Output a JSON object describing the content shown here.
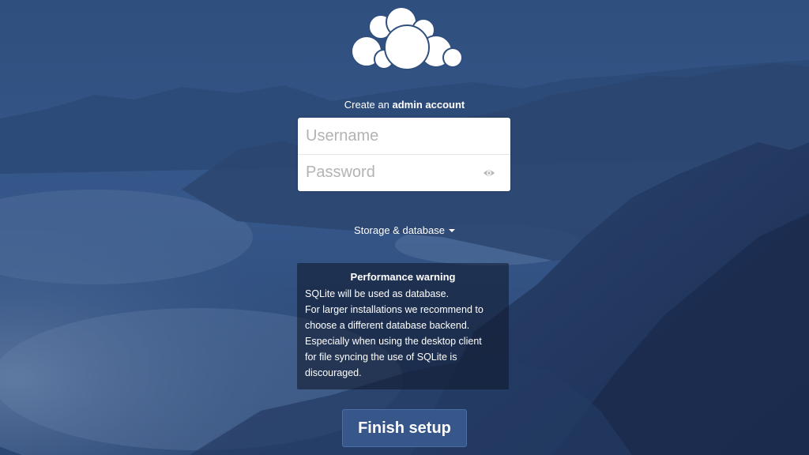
{
  "colors": {
    "background": "#2e4d7a",
    "button": "#37568a"
  },
  "logo": {
    "icon": "cloud-logo-icon"
  },
  "heading": {
    "prefix": "Create an",
    "emphasis": "admin account"
  },
  "form": {
    "username_placeholder": "Username",
    "password_placeholder": "Password",
    "password_icon": "eye-icon"
  },
  "storage": {
    "label": "Storage & database",
    "icon": "caret-down-icon"
  },
  "warning": {
    "title": "Performance warning",
    "lines": [
      "SQLite will be used as database.",
      "For larger installations we recommend to",
      "choose a different database backend.",
      "Especially when using the desktop client",
      "for file syncing the use of SQLite is",
      "discouraged."
    ]
  },
  "finish_button": {
    "label": "Finish setup"
  }
}
